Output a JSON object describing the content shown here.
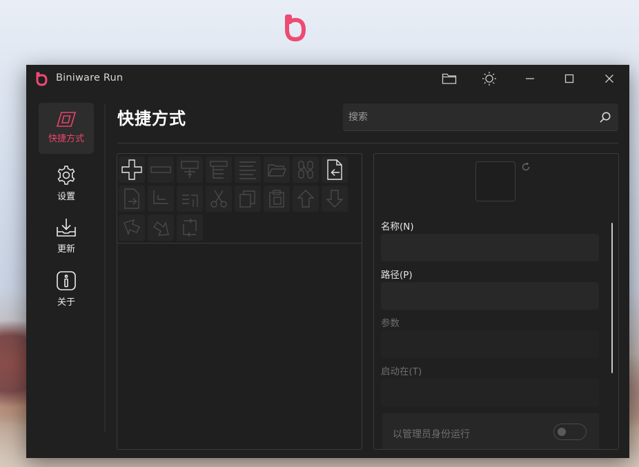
{
  "app": {
    "title": "Biniware Run",
    "accent_color": "#e8456a"
  },
  "titlebar": {
    "buttons": [
      "folder-icon",
      "sun-icon",
      "minimize-icon",
      "maximize-icon",
      "close-icon"
    ]
  },
  "nav": {
    "items": [
      {
        "label": "快捷方式",
        "icon": "shortcut-icon",
        "active": true
      },
      {
        "label": "设置",
        "icon": "gear-icon",
        "active": false
      },
      {
        "label": "更新",
        "icon": "download-icon",
        "active": false
      },
      {
        "label": "关于",
        "icon": "info-icon",
        "active": false
      }
    ]
  },
  "page": {
    "title": "快捷方式"
  },
  "search": {
    "placeholder": "搜索",
    "value": ""
  },
  "toolbar": {
    "buttons": [
      {
        "icon": "add-icon",
        "enabled": true
      },
      {
        "icon": "remove-icon",
        "enabled": false
      },
      {
        "icon": "add-separator-icon",
        "enabled": false
      },
      {
        "icon": "add-group-icon",
        "enabled": false
      },
      {
        "icon": "list-icon",
        "enabled": false
      },
      {
        "icon": "open-folder-icon",
        "enabled": false
      },
      {
        "icon": "link-icon",
        "enabled": false
      },
      {
        "icon": "import-icon",
        "enabled": true
      },
      {
        "icon": "export-icon",
        "enabled": false
      },
      {
        "icon": "indent-icon",
        "enabled": false
      },
      {
        "icon": "outdent-icon",
        "enabled": false
      },
      {
        "icon": "cut-icon",
        "enabled": false
      },
      {
        "icon": "copy-icon",
        "enabled": false
      },
      {
        "icon": "paste-icon",
        "enabled": false
      },
      {
        "icon": "move-up-icon",
        "enabled": false
      },
      {
        "icon": "move-down-icon",
        "enabled": false
      },
      {
        "icon": "move-left-icon",
        "enabled": false
      },
      {
        "icon": "move-right-icon",
        "enabled": false
      },
      {
        "icon": "swap-icon",
        "enabled": false
      }
    ]
  },
  "details": {
    "name_label": "名称(N)",
    "name_value": "",
    "path_label": "路径(P)",
    "path_value": "",
    "args_label": "参数",
    "args_value": "",
    "start_in_label": "启动在(T)",
    "start_in_value": "",
    "run_as_admin_label": "以管理员身份运行",
    "run_as_admin": false
  }
}
